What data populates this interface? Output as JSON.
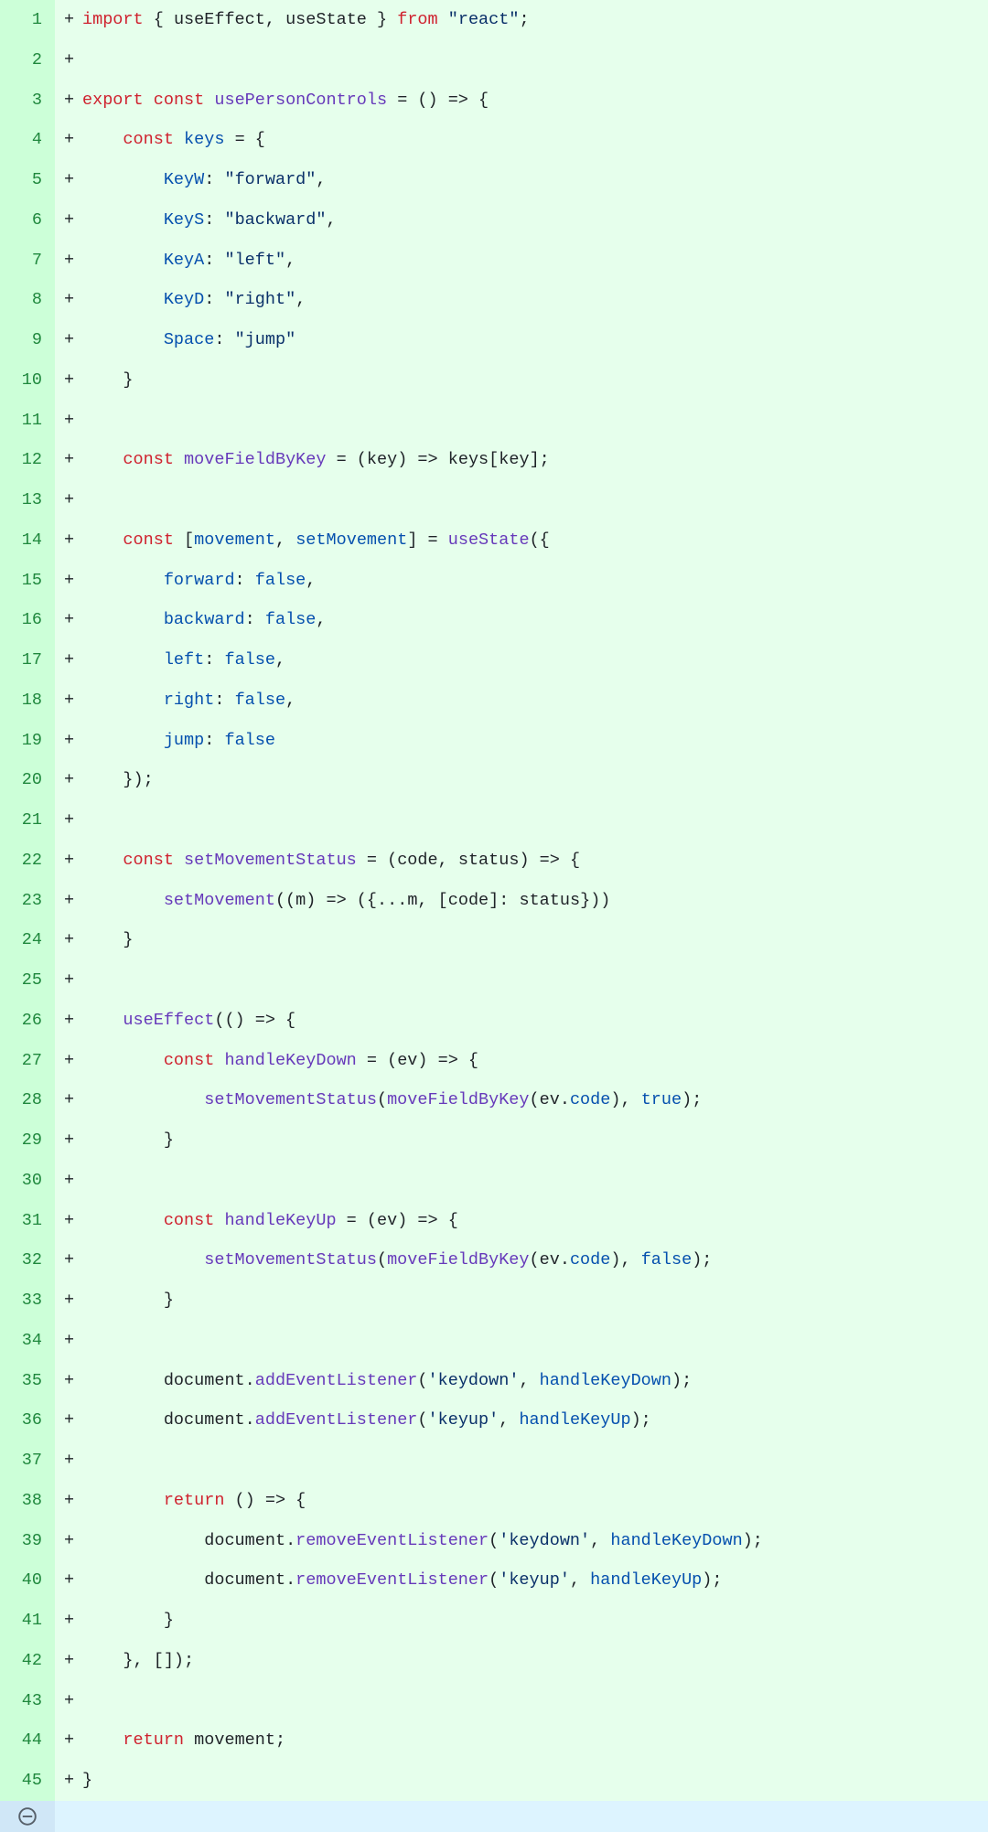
{
  "lines": [
    {
      "num": "1",
      "marker": "+",
      "tokens": [
        [
          "kw-import",
          "import"
        ],
        [
          "punct",
          " { "
        ],
        [
          "ident",
          "useEffect"
        ],
        [
          "punct",
          ", "
        ],
        [
          "ident",
          "useState"
        ],
        [
          "punct",
          " } "
        ],
        [
          "kw-from",
          "from"
        ],
        [
          "punct",
          " "
        ],
        [
          "str",
          "\"react\""
        ],
        [
          "punct",
          ";"
        ]
      ]
    },
    {
      "num": "2",
      "marker": "+",
      "tokens": []
    },
    {
      "num": "3",
      "marker": "+",
      "tokens": [
        [
          "kw-export",
          "export"
        ],
        [
          "punct",
          " "
        ],
        [
          "kw-const",
          "const"
        ],
        [
          "punct",
          " "
        ],
        [
          "fn",
          "usePersonControls"
        ],
        [
          "punct",
          " = () => {"
        ]
      ]
    },
    {
      "num": "4",
      "marker": "+",
      "tokens": [
        [
          "punct",
          "    "
        ],
        [
          "kw-const",
          "const"
        ],
        [
          "punct",
          " "
        ],
        [
          "prop",
          "keys"
        ],
        [
          "punct",
          " = {"
        ]
      ]
    },
    {
      "num": "5",
      "marker": "+",
      "tokens": [
        [
          "punct",
          "        "
        ],
        [
          "prop",
          "KeyW"
        ],
        [
          "punct",
          ": "
        ],
        [
          "str",
          "\"forward\""
        ],
        [
          "punct",
          ","
        ]
      ]
    },
    {
      "num": "6",
      "marker": "+",
      "tokens": [
        [
          "punct",
          "        "
        ],
        [
          "prop",
          "KeyS"
        ],
        [
          "punct",
          ": "
        ],
        [
          "str",
          "\"backward\""
        ],
        [
          "punct",
          ","
        ]
      ]
    },
    {
      "num": "7",
      "marker": "+",
      "tokens": [
        [
          "punct",
          "        "
        ],
        [
          "prop",
          "KeyA"
        ],
        [
          "punct",
          ": "
        ],
        [
          "str",
          "\"left\""
        ],
        [
          "punct",
          ","
        ]
      ]
    },
    {
      "num": "8",
      "marker": "+",
      "tokens": [
        [
          "punct",
          "        "
        ],
        [
          "prop",
          "KeyD"
        ],
        [
          "punct",
          ": "
        ],
        [
          "str",
          "\"right\""
        ],
        [
          "punct",
          ","
        ]
      ]
    },
    {
      "num": "9",
      "marker": "+",
      "tokens": [
        [
          "punct",
          "        "
        ],
        [
          "prop",
          "Space"
        ],
        [
          "punct",
          ": "
        ],
        [
          "str",
          "\"jump\""
        ]
      ]
    },
    {
      "num": "10",
      "marker": "+",
      "tokens": [
        [
          "punct",
          "    }"
        ]
      ]
    },
    {
      "num": "11",
      "marker": "+",
      "tokens": []
    },
    {
      "num": "12",
      "marker": "+",
      "tokens": [
        [
          "punct",
          "    "
        ],
        [
          "kw-const",
          "const"
        ],
        [
          "punct",
          " "
        ],
        [
          "fn",
          "moveFieldByKey"
        ],
        [
          "punct",
          " = ("
        ],
        [
          "ident",
          "key"
        ],
        [
          "punct",
          ") => "
        ],
        [
          "ident",
          "keys"
        ],
        [
          "punct",
          "["
        ],
        [
          "ident",
          "key"
        ],
        [
          "punct",
          "];"
        ]
      ]
    },
    {
      "num": "13",
      "marker": "+",
      "tokens": []
    },
    {
      "num": "14",
      "marker": "+",
      "tokens": [
        [
          "punct",
          "    "
        ],
        [
          "kw-const",
          "const"
        ],
        [
          "punct",
          " ["
        ],
        [
          "prop",
          "movement"
        ],
        [
          "punct",
          ", "
        ],
        [
          "prop",
          "setMovement"
        ],
        [
          "punct",
          "] = "
        ],
        [
          "fn",
          "useState"
        ],
        [
          "punct",
          "({"
        ]
      ]
    },
    {
      "num": "15",
      "marker": "+",
      "tokens": [
        [
          "punct",
          "        "
        ],
        [
          "prop",
          "forward"
        ],
        [
          "punct",
          ": "
        ],
        [
          "bool",
          "false"
        ],
        [
          "punct",
          ","
        ]
      ]
    },
    {
      "num": "16",
      "marker": "+",
      "tokens": [
        [
          "punct",
          "        "
        ],
        [
          "prop",
          "backward"
        ],
        [
          "punct",
          ": "
        ],
        [
          "bool",
          "false"
        ],
        [
          "punct",
          ","
        ]
      ]
    },
    {
      "num": "17",
      "marker": "+",
      "tokens": [
        [
          "punct",
          "        "
        ],
        [
          "prop",
          "left"
        ],
        [
          "punct",
          ": "
        ],
        [
          "bool",
          "false"
        ],
        [
          "punct",
          ","
        ]
      ]
    },
    {
      "num": "18",
      "marker": "+",
      "tokens": [
        [
          "punct",
          "        "
        ],
        [
          "prop",
          "right"
        ],
        [
          "punct",
          ": "
        ],
        [
          "bool",
          "false"
        ],
        [
          "punct",
          ","
        ]
      ]
    },
    {
      "num": "19",
      "marker": "+",
      "tokens": [
        [
          "punct",
          "        "
        ],
        [
          "prop",
          "jump"
        ],
        [
          "punct",
          ": "
        ],
        [
          "bool",
          "false"
        ]
      ]
    },
    {
      "num": "20",
      "marker": "+",
      "tokens": [
        [
          "punct",
          "    });"
        ]
      ]
    },
    {
      "num": "21",
      "marker": "+",
      "tokens": []
    },
    {
      "num": "22",
      "marker": "+",
      "tokens": [
        [
          "punct",
          "    "
        ],
        [
          "kw-const",
          "const"
        ],
        [
          "punct",
          " "
        ],
        [
          "fn",
          "setMovementStatus"
        ],
        [
          "punct",
          " = ("
        ],
        [
          "ident",
          "code"
        ],
        [
          "punct",
          ", "
        ],
        [
          "ident",
          "status"
        ],
        [
          "punct",
          ") => {"
        ]
      ]
    },
    {
      "num": "23",
      "marker": "+",
      "tokens": [
        [
          "punct",
          "        "
        ],
        [
          "fn",
          "setMovement"
        ],
        [
          "punct",
          "(("
        ],
        [
          "ident",
          "m"
        ],
        [
          "punct",
          ") => ({..."
        ],
        [
          "ident",
          "m"
        ],
        [
          "punct",
          ", ["
        ],
        [
          "ident",
          "code"
        ],
        [
          "punct",
          "]: "
        ],
        [
          "ident",
          "status"
        ],
        [
          "punct",
          "}))"
        ]
      ]
    },
    {
      "num": "24",
      "marker": "+",
      "tokens": [
        [
          "punct",
          "    }"
        ]
      ]
    },
    {
      "num": "25",
      "marker": "+",
      "tokens": []
    },
    {
      "num": "26",
      "marker": "+",
      "tokens": [
        [
          "punct",
          "    "
        ],
        [
          "fn",
          "useEffect"
        ],
        [
          "punct",
          "(() => {"
        ]
      ]
    },
    {
      "num": "27",
      "marker": "+",
      "tokens": [
        [
          "punct",
          "        "
        ],
        [
          "kw-const",
          "const"
        ],
        [
          "punct",
          " "
        ],
        [
          "fn",
          "handleKeyDown"
        ],
        [
          "punct",
          " = ("
        ],
        [
          "ident",
          "ev"
        ],
        [
          "punct",
          ") => {"
        ]
      ]
    },
    {
      "num": "28",
      "marker": "+",
      "tokens": [
        [
          "punct",
          "            "
        ],
        [
          "fn",
          "setMovementStatus"
        ],
        [
          "punct",
          "("
        ],
        [
          "fn",
          "moveFieldByKey"
        ],
        [
          "punct",
          "("
        ],
        [
          "ident",
          "ev"
        ],
        [
          "punct",
          "."
        ],
        [
          "prop",
          "code"
        ],
        [
          "punct",
          "), "
        ],
        [
          "bool",
          "true"
        ],
        [
          "punct",
          ");"
        ]
      ]
    },
    {
      "num": "29",
      "marker": "+",
      "tokens": [
        [
          "punct",
          "        }"
        ]
      ]
    },
    {
      "num": "30",
      "marker": "+",
      "tokens": []
    },
    {
      "num": "31",
      "marker": "+",
      "tokens": [
        [
          "punct",
          "        "
        ],
        [
          "kw-const",
          "const"
        ],
        [
          "punct",
          " "
        ],
        [
          "fn",
          "handleKeyUp"
        ],
        [
          "punct",
          " = ("
        ],
        [
          "ident",
          "ev"
        ],
        [
          "punct",
          ") => {"
        ]
      ]
    },
    {
      "num": "32",
      "marker": "+",
      "tokens": [
        [
          "punct",
          "            "
        ],
        [
          "fn",
          "setMovementStatus"
        ],
        [
          "punct",
          "("
        ],
        [
          "fn",
          "moveFieldByKey"
        ],
        [
          "punct",
          "("
        ],
        [
          "ident",
          "ev"
        ],
        [
          "punct",
          "."
        ],
        [
          "prop",
          "code"
        ],
        [
          "punct",
          "), "
        ],
        [
          "bool",
          "false"
        ],
        [
          "punct",
          ");"
        ]
      ]
    },
    {
      "num": "33",
      "marker": "+",
      "tokens": [
        [
          "punct",
          "        }"
        ]
      ]
    },
    {
      "num": "34",
      "marker": "+",
      "tokens": []
    },
    {
      "num": "35",
      "marker": "+",
      "tokens": [
        [
          "punct",
          "        "
        ],
        [
          "ident",
          "document"
        ],
        [
          "punct",
          "."
        ],
        [
          "fn",
          "addEventListener"
        ],
        [
          "punct",
          "("
        ],
        [
          "str",
          "'keydown'"
        ],
        [
          "punct",
          ", "
        ],
        [
          "prop",
          "handleKeyDown"
        ],
        [
          "punct",
          ");"
        ]
      ]
    },
    {
      "num": "36",
      "marker": "+",
      "tokens": [
        [
          "punct",
          "        "
        ],
        [
          "ident",
          "document"
        ],
        [
          "punct",
          "."
        ],
        [
          "fn",
          "addEventListener"
        ],
        [
          "punct",
          "("
        ],
        [
          "str",
          "'keyup'"
        ],
        [
          "punct",
          ", "
        ],
        [
          "prop",
          "handleKeyUp"
        ],
        [
          "punct",
          ");"
        ]
      ]
    },
    {
      "num": "37",
      "marker": "+",
      "tokens": []
    },
    {
      "num": "38",
      "marker": "+",
      "tokens": [
        [
          "punct",
          "        "
        ],
        [
          "kw-return",
          "return"
        ],
        [
          "punct",
          " () => {"
        ]
      ]
    },
    {
      "num": "39",
      "marker": "+",
      "tokens": [
        [
          "punct",
          "            "
        ],
        [
          "ident",
          "document"
        ],
        [
          "punct",
          "."
        ],
        [
          "fn",
          "removeEventListener"
        ],
        [
          "punct",
          "("
        ],
        [
          "str",
          "'keydown'"
        ],
        [
          "punct",
          ", "
        ],
        [
          "prop",
          "handleKeyDown"
        ],
        [
          "punct",
          ");"
        ]
      ]
    },
    {
      "num": "40",
      "marker": "+",
      "tokens": [
        [
          "punct",
          "            "
        ],
        [
          "ident",
          "document"
        ],
        [
          "punct",
          "."
        ],
        [
          "fn",
          "removeEventListener"
        ],
        [
          "punct",
          "("
        ],
        [
          "str",
          "'keyup'"
        ],
        [
          "punct",
          ", "
        ],
        [
          "prop",
          "handleKeyUp"
        ],
        [
          "punct",
          ");"
        ]
      ]
    },
    {
      "num": "41",
      "marker": "+",
      "tokens": [
        [
          "punct",
          "        }"
        ]
      ]
    },
    {
      "num": "42",
      "marker": "+",
      "tokens": [
        [
          "punct",
          "    }, []);"
        ]
      ]
    },
    {
      "num": "43",
      "marker": "+",
      "tokens": []
    },
    {
      "num": "44",
      "marker": "+",
      "tokens": [
        [
          "punct",
          "    "
        ],
        [
          "kw-return",
          "return"
        ],
        [
          "punct",
          " "
        ],
        [
          "ident",
          "movement"
        ],
        [
          "punct",
          ";"
        ]
      ]
    },
    {
      "num": "45",
      "marker": "+",
      "tokens": [
        [
          "punct",
          "}"
        ]
      ]
    }
  ]
}
